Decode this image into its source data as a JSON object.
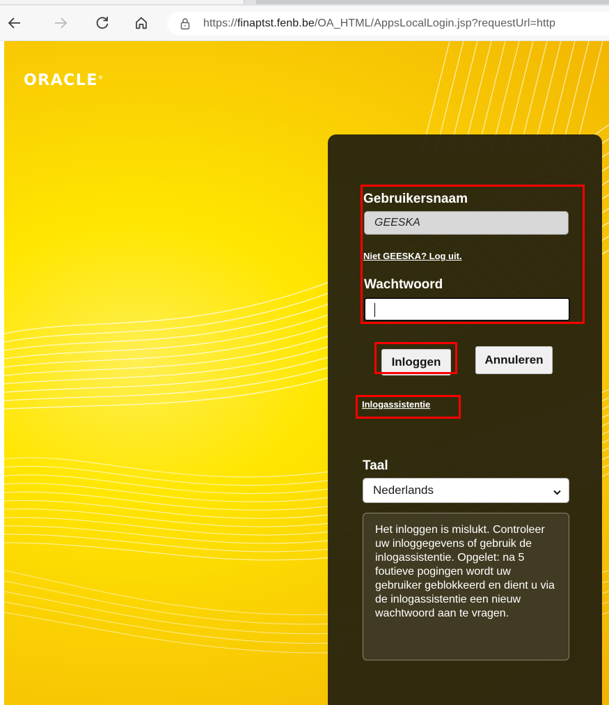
{
  "browser": {
    "url_scheme": "https://",
    "url_host": "finaptst.fenb.be",
    "url_path": "/OA_HTML/AppsLocalLogin.jsp?requestUrl=http"
  },
  "page": {
    "logo": "ORACLE",
    "login": {
      "username_label": "Gebruikersnaam",
      "username_value": "GEESKA",
      "logout_link": "Niet GEESKA? Log uit.",
      "password_label": "Wachtwoord",
      "password_value": "",
      "login_button": "Inloggen",
      "cancel_button": "Annuleren",
      "assistance_link": "Inlogassistentie"
    },
    "language": {
      "label": "Taal",
      "selected": "Nederlands"
    },
    "error_message": "Het inloggen is mislukt. Controleer uw inloggegevens of gebruik de inlogassistentie. Opgelet: na 5 foutieve pogingen wordt uw gebruiker geblokkeerd en dient u via de inlogassistentie een nieuw wachtwoord aan te vragen."
  },
  "colors": {
    "background_yellow": "#ffe600",
    "panel": "#211e0e",
    "highlight": "#ff0000"
  }
}
